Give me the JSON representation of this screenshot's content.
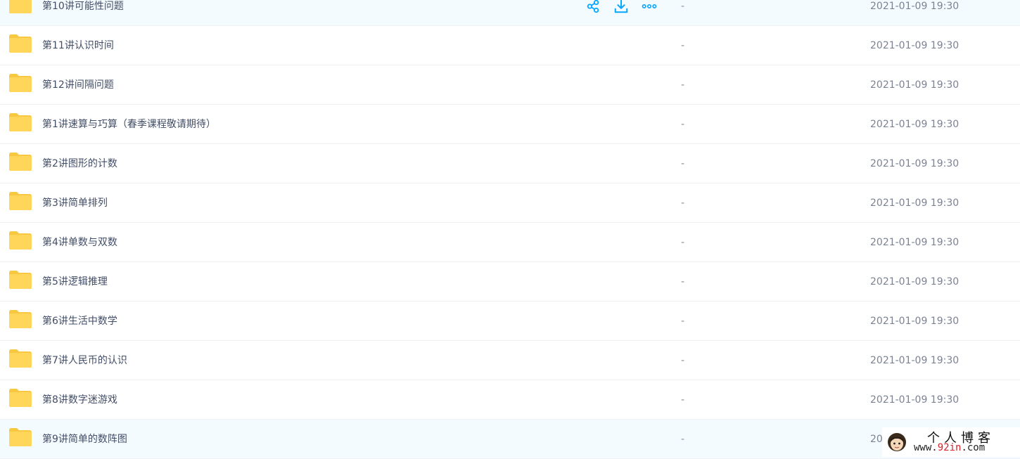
{
  "files": [
    {
      "name": "第10讲可能性问题",
      "size": "-",
      "modified": "2021-01-09 19:30",
      "state": "hover"
    },
    {
      "name": "第11讲认识时间",
      "size": "-",
      "modified": "2021-01-09 19:30"
    },
    {
      "name": "第12讲间隔问题",
      "size": "-",
      "modified": "2021-01-09 19:30"
    },
    {
      "name": "第1讲速算与巧算（春季课程敬请期待）",
      "size": "-",
      "modified": "2021-01-09 19:30"
    },
    {
      "name": "第2讲图形的计数",
      "size": "-",
      "modified": "2021-01-09 19:30"
    },
    {
      "name": "第3讲简单排列",
      "size": "-",
      "modified": "2021-01-09 19:30"
    },
    {
      "name": "第4讲单数与双数",
      "size": "-",
      "modified": "2021-01-09 19:30"
    },
    {
      "name": "第5讲逻辑推理",
      "size": "-",
      "modified": "2021-01-09 19:30"
    },
    {
      "name": "第6讲生活中数学",
      "size": "-",
      "modified": "2021-01-09 19:30"
    },
    {
      "name": "第7讲人民币的认识",
      "size": "-",
      "modified": "2021-01-09 19:30"
    },
    {
      "name": "第8讲数字迷游戏",
      "size": "-",
      "modified": "2021-01-09 19:30"
    },
    {
      "name": "第9讲简单的数阵图",
      "size": "-",
      "modified": "20",
      "state": "selected"
    }
  ],
  "row_actions": [
    {
      "icon": "share-icon"
    },
    {
      "icon": "download-icon"
    },
    {
      "icon": "more-icon"
    }
  ],
  "watermark": {
    "title": "个人博客",
    "url_prefix": "www.",
    "url_highlight": "92in",
    "url_suffix": ".com"
  },
  "colors": {
    "accent": "#06a7ff",
    "folder": "#ffd659",
    "folder_tab": "#f9c841",
    "row_hover": "#f4fbff",
    "text": "#424e67",
    "muted": "#7b8292"
  }
}
